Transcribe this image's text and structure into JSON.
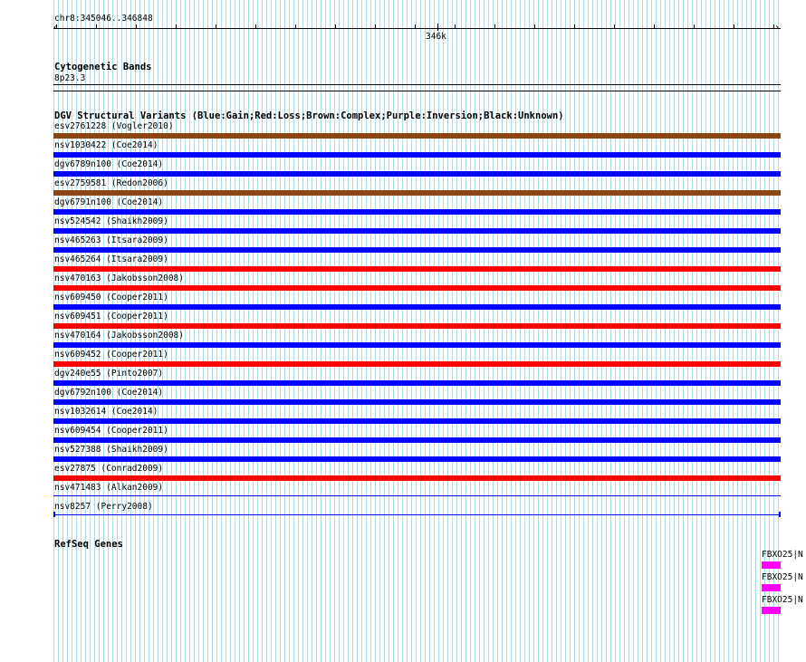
{
  "ruler": {
    "position": "chr8:345046..346848",
    "tick_label": "346k"
  },
  "cytoband": {
    "title": "Cytogenetic Bands",
    "band": "8p23.3"
  },
  "dgv": {
    "title": "DGV Structural Variants (Blue:Gain;Red:Loss;Brown:Complex;Purple:Inversion;Black:Unknown)",
    "colors": {
      "gain": "#0000ff",
      "loss": "#ff0000",
      "complex": "#8b4513"
    },
    "variants": [
      {
        "label": "esv2761228 (Vogler2010)",
        "type": "complex"
      },
      {
        "label": "nsv1030422 (Coe2014)",
        "type": "gain"
      },
      {
        "label": "dgv6789n100 (Coe2014)",
        "type": "gain"
      },
      {
        "label": "esv2759581 (Redon2006)",
        "type": "complex"
      },
      {
        "label": "dgv6791n100 (Coe2014)",
        "type": "gain"
      },
      {
        "label": "nsv524542 (Shaikh2009)",
        "type": "gain"
      },
      {
        "label": "nsv465263 (Itsara2009)",
        "type": "gain"
      },
      {
        "label": "nsv465264 (Itsara2009)",
        "type": "loss"
      },
      {
        "label": "nsv470163 (Jakobsson2008)",
        "type": "loss"
      },
      {
        "label": "nsv609450 (Cooper2011)",
        "type": "gain"
      },
      {
        "label": "nsv609451 (Cooper2011)",
        "type": "loss"
      },
      {
        "label": "nsv470164 (Jakobsson2008)",
        "type": "gain"
      },
      {
        "label": "nsv609452 (Cooper2011)",
        "type": "loss"
      },
      {
        "label": "dgv240e55 (Pinto2007)",
        "type": "gain"
      },
      {
        "label": "dgv6792n100 (Coe2014)",
        "type": "gain"
      },
      {
        "label": "nsv1032614 (Coe2014)",
        "type": "gain"
      },
      {
        "label": "nsv609454 (Cooper2011)",
        "type": "gain"
      },
      {
        "label": "nsv527388 (Shaikh2009)",
        "type": "gain"
      },
      {
        "label": "esv27875 (Conrad2009)",
        "type": "loss"
      },
      {
        "label": "nsv471483 (Alkan2009)",
        "type": "gain-thin"
      },
      {
        "label": "nsv8257 (Perry2008)",
        "type": "gain-thin-end"
      }
    ]
  },
  "refseq": {
    "title": "RefSeq Genes",
    "genes": [
      {
        "label": "FBXO25|N"
      },
      {
        "label": "FBXO25|N"
      },
      {
        "label": "FBXO25|N"
      }
    ]
  }
}
